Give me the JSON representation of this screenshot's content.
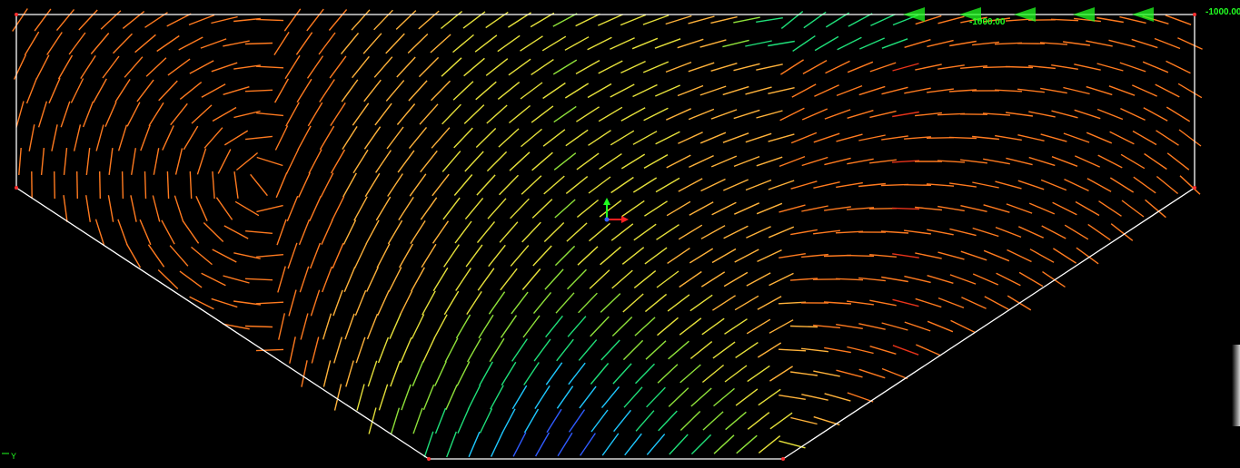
{
  "viewport": {
    "background": "#000000",
    "boundary_color": "#ffffff",
    "node_color": "#ff3030"
  },
  "load": {
    "values": [
      "-1000.00",
      "-1000.00"
    ],
    "color": "#22ff22",
    "arrow_icon": "load-arrow-icon"
  },
  "axis": {
    "x_color": "#ff2020",
    "y_color": "#20ff20",
    "z_color": "#3060ff",
    "corner_label": "Y"
  },
  "colormap": [
    "#8a2be2",
    "#2f5bff",
    "#1ec8ff",
    "#1fe07a",
    "#8fe23a",
    "#e6e13a",
    "#ffb23a",
    "#ff7a1f",
    "#e8331a"
  ]
}
